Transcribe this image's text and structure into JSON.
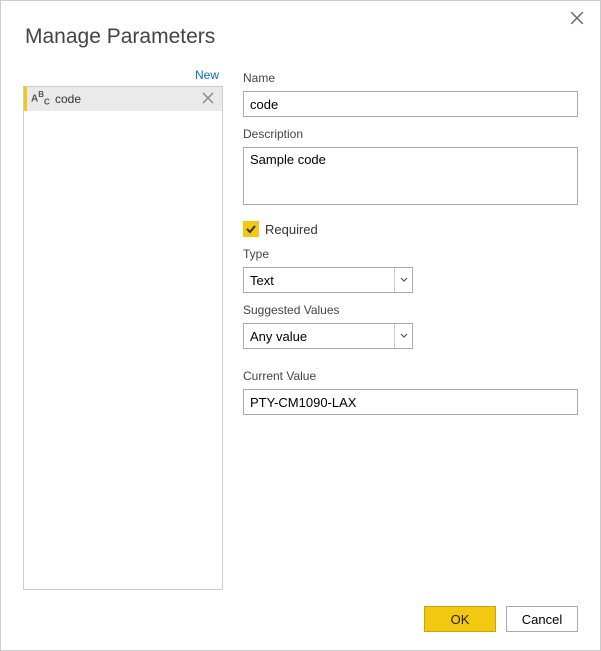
{
  "title": "Manage Parameters",
  "left": {
    "new_label": "New",
    "items": [
      {
        "name": "code"
      }
    ]
  },
  "form": {
    "name_label": "Name",
    "name_value": "code",
    "description_label": "Description",
    "description_value": "Sample code",
    "required_label": "Required",
    "required_checked": true,
    "type_label": "Type",
    "type_value": "Text",
    "suggested_label": "Suggested Values",
    "suggested_value": "Any value",
    "current_label": "Current Value",
    "current_value": "PTY-CM1090-LAX"
  },
  "footer": {
    "ok": "OK",
    "cancel": "Cancel"
  },
  "colors": {
    "accent": "#f2c811",
    "link": "#0f6cbd"
  }
}
